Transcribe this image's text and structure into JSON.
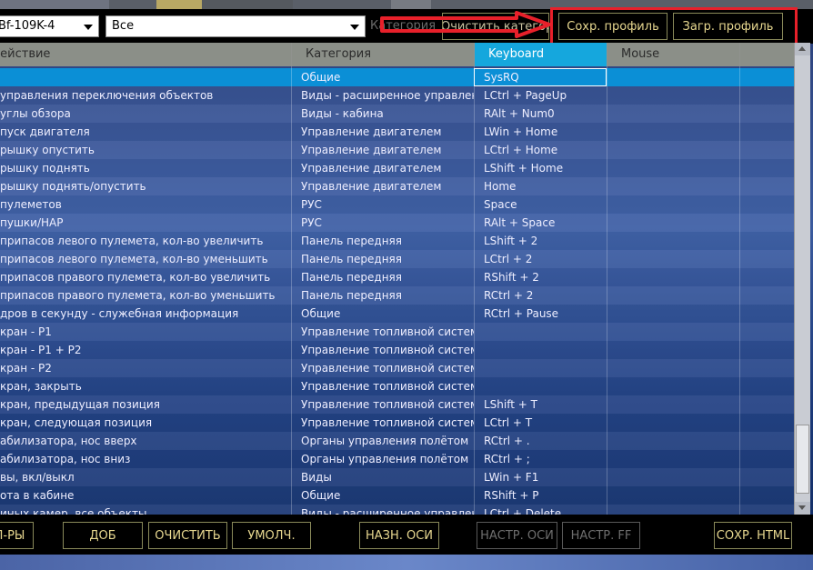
{
  "toolbar": {
    "aircraft_select": "Bf-109K-4",
    "filter_select": "Все",
    "category_label": "Категория",
    "clear_category": "Очистить категорию",
    "save_profile": "Сохр. профиль",
    "load_profile": "Загр. профиль"
  },
  "columns": {
    "action": "Действие",
    "category": "Категория",
    "keyboard": "Keyboard",
    "mouse": "Mouse"
  },
  "rows": [
    {
      "action": "",
      "category": "Общие",
      "keyboard": "SysRQ",
      "mouse": "",
      "selected": true
    },
    {
      "action": "управления переключения объектов",
      "category": "Виды - расширенное управление",
      "keyboard": "LCtrl + PageUp",
      "mouse": ""
    },
    {
      "action": "углы обзора",
      "category": "Виды - кабина",
      "keyboard": "RAlt + Num0",
      "mouse": ""
    },
    {
      "action": "пуск двигателя",
      "category": "Управление двигателем",
      "keyboard": "LWin + Home",
      "mouse": ""
    },
    {
      "action": "рышку опустить",
      "category": "Управление двигателем",
      "keyboard": "LCtrl + Home",
      "mouse": ""
    },
    {
      "action": "рышку поднять",
      "category": "Управление двигателем",
      "keyboard": "LShift + Home",
      "mouse": ""
    },
    {
      "action": "рышку поднять/опустить",
      "category": "Управление двигателем",
      "keyboard": "Home",
      "mouse": ""
    },
    {
      "action": " пулеметов",
      "category": "РУС",
      "keyboard": "Space",
      "mouse": ""
    },
    {
      "action": " пушки/НАР",
      "category": "РУС",
      "keyboard": "RAlt + Space",
      "mouse": ""
    },
    {
      "action": "припасов левого пулемета, кол-во увеличить",
      "category": "Панель передняя",
      "keyboard": "LShift + 2",
      "mouse": ""
    },
    {
      "action": "припасов левого пулемета, кол-во уменьшить",
      "category": "Панель передняя",
      "keyboard": "LCtrl + 2",
      "mouse": ""
    },
    {
      "action": "припасов правого пулемета, кол-во увеличить",
      "category": "Панель передняя",
      "keyboard": "RShift + 2",
      "mouse": ""
    },
    {
      "action": "припасов правого пулемета, кол-во уменьшить",
      "category": "Панель передняя",
      "keyboard": "RCtrl + 2",
      "mouse": ""
    },
    {
      "action": "дров в секунду - служебная информация",
      "category": "Общие",
      "keyboard": "RCtrl + Pause",
      "mouse": ""
    },
    {
      "action": "кран - P1",
      "category": "Управление топливной системой",
      "keyboard": "",
      "mouse": ""
    },
    {
      "action": "кран - P1 + P2",
      "category": "Управление топливной системой",
      "keyboard": "",
      "mouse": ""
    },
    {
      "action": "кран - P2",
      "category": "Управление топливной системой",
      "keyboard": "",
      "mouse": ""
    },
    {
      "action": "кран, закрыть",
      "category": "Управление топливной системой",
      "keyboard": "",
      "mouse": ""
    },
    {
      "action": "кран, предыдущая позиция",
      "category": "Управление топливной системой",
      "keyboard": "LShift + T",
      "mouse": ""
    },
    {
      "action": "кран, следующая позиция",
      "category": "Управление топливной системой",
      "keyboard": "LCtrl + T",
      "mouse": ""
    },
    {
      "action": "абилизатора, нос вверх",
      "category": "Органы управления полётом",
      "keyboard": "RCtrl + .",
      "mouse": ""
    },
    {
      "action": "абилизатора, нос вниз",
      "category": "Органы управления полётом",
      "keyboard": "RCtrl + ;",
      "mouse": ""
    },
    {
      "action": "вы, вкл/выкл",
      "category": "Виды",
      "keyboard": "LWin + F1",
      "mouse": ""
    },
    {
      "action": "ота в кабине",
      "category": "Общие",
      "keyboard": "RShift + P",
      "mouse": ""
    },
    {
      "action": "иных камер, все объекты",
      "category": "Виды - расширенное управление",
      "keyboard": "LCtrl + Delete",
      "mouse": ""
    }
  ],
  "bottom_buttons": {
    "params": "П-РЫ",
    "add": "ДОБ",
    "clear": "ОЧИСТИТЬ",
    "default": "УМОЛЧ.",
    "assign_axis": "НАЗН. ОСИ",
    "axis_settings": "НАСТР. ОСИ",
    "ff_settings": "НАСТР. FF",
    "save_html": "СОХР. HTML"
  },
  "colors": {
    "accent_selected": "#0b8fd6",
    "keyboard_header": "#15a7dd",
    "button_text": "#e8d890",
    "highlight_red": "#e8202a"
  }
}
